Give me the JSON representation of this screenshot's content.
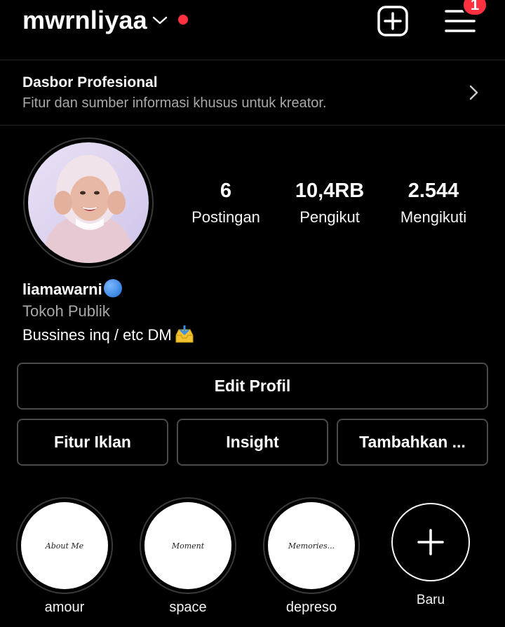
{
  "header": {
    "username": "mwrnliyaa",
    "notification_count": "1"
  },
  "dashboard": {
    "title": "Dasbor Profesional",
    "subtitle": "Fitur dan sumber informasi khusus untuk kreator."
  },
  "profile": {
    "stats": [
      {
        "value": "6",
        "label": "Postingan"
      },
      {
        "value": "10,4RB",
        "label": "Pengikut"
      },
      {
        "value": "2.544",
        "label": "Mengikuti"
      }
    ],
    "display_name": "liamawarni",
    "category": "Tokoh Publik",
    "bio": "Bussines inq / etc DM"
  },
  "buttons": {
    "edit_profile": "Edit Profil",
    "ads": "Fitur Iklan",
    "insight": "Insight",
    "more": "Tambahkan ..."
  },
  "highlights": [
    {
      "label": "amour",
      "cover_text": "About Me"
    },
    {
      "label": "space",
      "cover_text": "Moment"
    },
    {
      "label": "depreso",
      "cover_text": "Memories..."
    }
  ],
  "new_highlight": {
    "label": "Baru"
  },
  "colors": {
    "background": "#000000",
    "accent_red": "#ff3040",
    "secondary_text": "#a8a8a8"
  }
}
